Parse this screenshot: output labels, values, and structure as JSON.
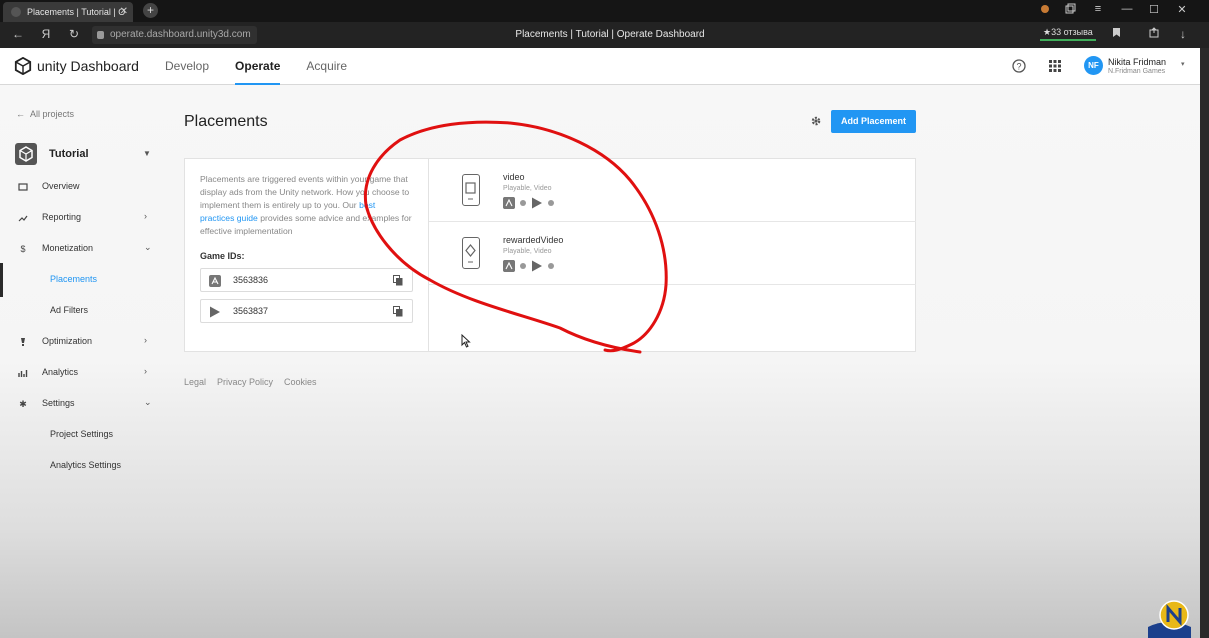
{
  "browser": {
    "tab_title": "Placements | Tutorial | O",
    "tab_close": "✕",
    "new_tab": "+",
    "nav_back": "←",
    "nav_yandex": "Я",
    "nav_reload": "↻",
    "url": "operate.dashboard.unity3d.com",
    "page_title": "Placements | Tutorial | Operate Dashboard",
    "reviews": "★33 отзыва",
    "win_minimize": "—",
    "win_maximize": "☐",
    "win_close": "✕",
    "menu": "≡",
    "download": "↓"
  },
  "header": {
    "logo_text": "unity Dashboard",
    "nav": [
      "Develop",
      "Operate",
      "Acquire"
    ],
    "active_nav": "Operate",
    "user_initials": "NF",
    "user_name": "Nikita Fridman",
    "user_org": "N.Fridman Games"
  },
  "sidebar": {
    "back_label": "All projects",
    "project_name": "Tutorial",
    "items": [
      {
        "label": "Overview",
        "icon": "overview-icon"
      },
      {
        "label": "Reporting",
        "icon": "trend-icon"
      },
      {
        "label": "Monetization",
        "icon": "dollar-icon"
      },
      {
        "label": "Placements",
        "icon": ""
      },
      {
        "label": "Ad Filters",
        "icon": ""
      },
      {
        "label": "Optimization",
        "icon": "bulb-icon"
      },
      {
        "label": "Analytics",
        "icon": "analytics-icon"
      },
      {
        "label": "Settings",
        "icon": "gear-icon"
      },
      {
        "label": "Project Settings",
        "icon": ""
      },
      {
        "label": "Analytics Settings",
        "icon": ""
      }
    ]
  },
  "main": {
    "title": "Placements",
    "add_button": "Add Placement",
    "desc_before": "Placements are triggered events within your game that display ads from the Unity network. How you choose to implement them is entirely up to you. Our ",
    "desc_link": "best practices guide",
    "desc_after": " provides some advice and examples for effective implementation",
    "game_ids_label": "Game IDs:",
    "game_ids": [
      {
        "platform": "apple-store-icon",
        "id": "3563836"
      },
      {
        "platform": "google-play-icon",
        "id": "3563837"
      }
    ],
    "placements": [
      {
        "name": "video",
        "types": "Playable, Video"
      },
      {
        "name": "rewardedVideo",
        "types": "Playable, Video"
      }
    ]
  },
  "footer": {
    "links": [
      "Legal",
      "Privacy Policy",
      "Cookies"
    ]
  },
  "colors": {
    "accent": "#2196f3",
    "annotation": "#e01010"
  }
}
